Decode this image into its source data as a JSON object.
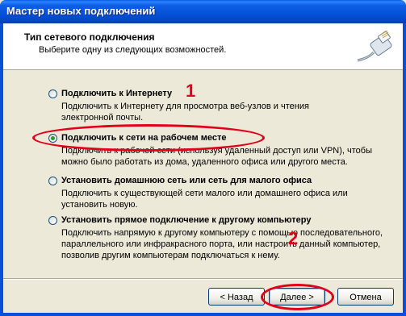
{
  "window": {
    "title": "Мастер новых подключений"
  },
  "header": {
    "title": "Тип сетевого подключения",
    "subtitle": "Выберите одну из следующих возможностей.",
    "icon": "network-cable-icon"
  },
  "options": [
    {
      "label": "Подключить к Интернету",
      "desc": "Подключить к Интернету для просмотра веб-узлов и чтения  электронной почты.",
      "selected": false
    },
    {
      "label": "Подключить к сети на рабочем месте",
      "desc": "Подключить к рабочей сети (используя удаленный доступ или VPN), чтобы можно было работать из дома, удаленного офиса или другого места.",
      "selected": true
    },
    {
      "label": "Установить домашнюю сеть или сеть для малого офиса",
      "desc": "Подключить к существующей сети малого или домашнего офиса или установить новую.",
      "selected": false
    },
    {
      "label": "Установить прямое подключение к другому компьютеру",
      "desc": "Подключить напрямую к другому компьютеру с помощью последовательного, параллельного или инфракрасного порта, или настроить данный компьютер, позволив другим  компьютерам подключаться к нему.",
      "selected": false
    }
  ],
  "buttons": {
    "back": "< Назад",
    "next": "Далее >",
    "cancel": "Отмена"
  },
  "annotations": {
    "mark1": "1",
    "mark2": "2"
  },
  "colors": {
    "titlebar": "#0551d8",
    "annotation": "#e3001b",
    "radio_selected": "#21a121"
  }
}
